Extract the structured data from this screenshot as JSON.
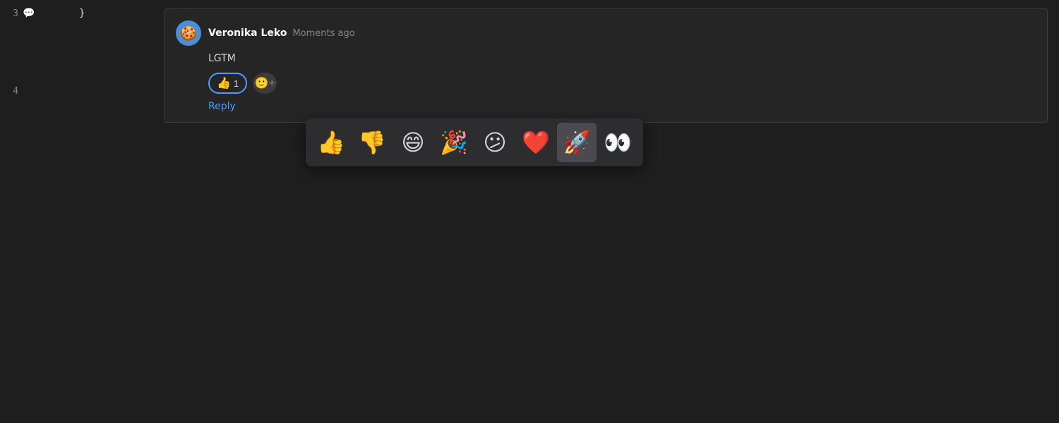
{
  "sidebar": {
    "line3": "3",
    "line4": "4",
    "comment_icon": "💬",
    "code_line3": "}",
    "code_line4": ""
  },
  "comment": {
    "author": "Veronika Leko",
    "timestamp": "Moments ago",
    "body": "LGTM",
    "avatar_emoji": "🍪",
    "reaction_thumbsup_emoji": "👍",
    "reaction_thumbsup_count": "1",
    "add_reaction_icon": "🙂",
    "reply_label": "Reply"
  },
  "emoji_picker": {
    "emojis": [
      {
        "id": "thumbsup",
        "char": "👍",
        "label": "thumbs up",
        "active": false
      },
      {
        "id": "thumbsdown",
        "char": "👎",
        "label": "thumbs down",
        "active": false
      },
      {
        "id": "grin",
        "char": "😄",
        "label": "grinning",
        "active": false
      },
      {
        "id": "party",
        "char": "🎉",
        "label": "party popper",
        "active": false
      },
      {
        "id": "confused",
        "char": "😕",
        "label": "confused",
        "active": false
      },
      {
        "id": "heart",
        "char": "❤️",
        "label": "heart",
        "active": false
      },
      {
        "id": "rocket",
        "char": "🚀",
        "label": "rocket",
        "active": true
      },
      {
        "id": "eyes",
        "char": "👀",
        "label": "eyes",
        "active": false
      }
    ]
  }
}
